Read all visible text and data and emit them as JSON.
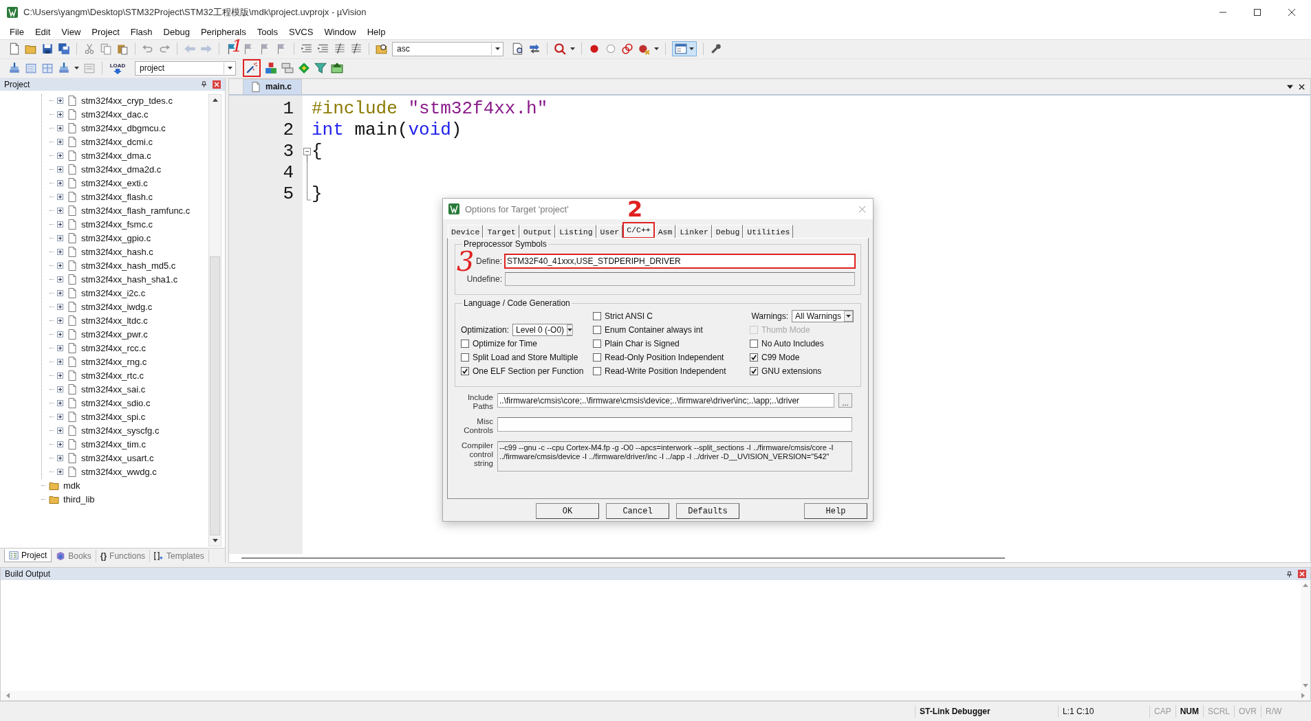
{
  "window": {
    "title": "C:\\Users\\yangm\\Desktop\\STM32Project\\STM32工程模版\\mdk\\project.uvprojx - µVision"
  },
  "menu": [
    "File",
    "Edit",
    "View",
    "Project",
    "Flash",
    "Debug",
    "Peripherals",
    "Tools",
    "SVCS",
    "Window",
    "Help"
  ],
  "toolbar": {
    "find_text": "asc",
    "target": "project",
    "load_label": "LOAD",
    "options_highlighted": true
  },
  "annotations": [
    {
      "text": "1"
    },
    {
      "text": "2"
    },
    {
      "text": "3"
    }
  ],
  "project_panel": {
    "title": "Project",
    "tree": [
      {
        "kind": "group",
        "children": [
          {
            "kind": "file",
            "label": "stm32f4xx_cryp_tdes.c",
            "expanded": false
          },
          {
            "kind": "file",
            "label": "stm32f4xx_dac.c",
            "expanded": false
          },
          {
            "kind": "file",
            "label": "stm32f4xx_dbgmcu.c",
            "expanded": false
          },
          {
            "kind": "file",
            "label": "stm32f4xx_dcmi.c",
            "expanded": false
          },
          {
            "kind": "file",
            "label": "stm32f4xx_dma.c",
            "expanded": false
          },
          {
            "kind": "file",
            "label": "stm32f4xx_dma2d.c",
            "expanded": false
          },
          {
            "kind": "file",
            "label": "stm32f4xx_exti.c",
            "expanded": false
          },
          {
            "kind": "file",
            "label": "stm32f4xx_flash.c",
            "expanded": false
          },
          {
            "kind": "file",
            "label": "stm32f4xx_flash_ramfunc.c",
            "expanded": false
          },
          {
            "kind": "file",
            "label": "stm32f4xx_fsmc.c",
            "expanded": false
          },
          {
            "kind": "file",
            "label": "stm32f4xx_gpio.c",
            "expanded": false
          },
          {
            "kind": "file",
            "label": "stm32f4xx_hash.c",
            "expanded": false
          },
          {
            "kind": "file",
            "label": "stm32f4xx_hash_md5.c",
            "expanded": false
          },
          {
            "kind": "file",
            "label": "stm32f4xx_hash_sha1.c",
            "expanded": false
          },
          {
            "kind": "file",
            "label": "stm32f4xx_i2c.c",
            "expanded": false
          },
          {
            "kind": "file",
            "label": "stm32f4xx_iwdg.c",
            "expanded": false
          },
          {
            "kind": "file",
            "label": "stm32f4xx_ltdc.c",
            "expanded": false
          },
          {
            "kind": "file",
            "label": "stm32f4xx_pwr.c",
            "expanded": false
          },
          {
            "kind": "file",
            "label": "stm32f4xx_rcc.c",
            "expanded": false
          },
          {
            "kind": "file",
            "label": "stm32f4xx_rng.c",
            "expanded": false
          },
          {
            "kind": "file",
            "label": "stm32f4xx_rtc.c",
            "expanded": false
          },
          {
            "kind": "file",
            "label": "stm32f4xx_sai.c",
            "expanded": false
          },
          {
            "kind": "file",
            "label": "stm32f4xx_sdio.c",
            "expanded": false
          },
          {
            "kind": "file",
            "label": "stm32f4xx_spi.c",
            "expanded": false
          },
          {
            "kind": "file",
            "label": "stm32f4xx_syscfg.c",
            "expanded": false
          },
          {
            "kind": "file",
            "label": "stm32f4xx_tim.c",
            "expanded": false
          },
          {
            "kind": "file",
            "label": "stm32f4xx_usart.c",
            "expanded": false
          },
          {
            "kind": "file",
            "label": "stm32f4xx_wwdg.c",
            "expanded": false
          }
        ]
      },
      {
        "kind": "folder",
        "label": "mdk"
      },
      {
        "kind": "folder",
        "label": "third_lib"
      }
    ],
    "tabs": [
      {
        "label": "Project",
        "selected": true
      },
      {
        "label": "Books",
        "selected": false
      },
      {
        "label": "Functions",
        "glyph": "{}",
        "selected": false
      },
      {
        "label": "Templates",
        "selected": false
      }
    ]
  },
  "editor": {
    "tabs": [
      {
        "label": "main.c",
        "selected": true
      }
    ],
    "lines": [
      {
        "number": "1",
        "tokens": [
          {
            "kind": "preprocessor",
            "text": "#include "
          },
          {
            "kind": "string",
            "text": "\"stm32f4xx.h\""
          }
        ]
      },
      {
        "number": "2",
        "tokens": [
          {
            "kind": "keyword",
            "text": "int"
          },
          {
            "kind": "plain",
            "text": " main("
          },
          {
            "kind": "keyword",
            "text": "void"
          },
          {
            "kind": "plain",
            "text": ")"
          }
        ]
      },
      {
        "number": "3",
        "fold_open": true,
        "tokens": [
          {
            "kind": "plain",
            "text": "{"
          }
        ]
      },
      {
        "number": "4"
      },
      {
        "number": "5",
        "tokens": [
          {
            "kind": "plain",
            "text": "}"
          }
        ]
      }
    ]
  },
  "dialog": {
    "title": "Options for Target 'project'",
    "tabs": [
      {
        "label": "Device",
        "selected": false
      },
      {
        "label": "Target",
        "selected": false
      },
      {
        "label": "Output",
        "selected": false
      },
      {
        "label": "Listing",
        "selected": false
      },
      {
        "label": "User",
        "selected": false
      },
      {
        "label": "C/C++",
        "selected": true,
        "highlighted": true
      },
      {
        "label": "Asm",
        "selected": false
      },
      {
        "label": "Linker",
        "selected": false
      },
      {
        "label": "Debug",
        "selected": false
      },
      {
        "label": "Utilities",
        "selected": false
      }
    ],
    "preprocessor": {
      "title": "Preprocessor Symbols",
      "define": {
        "label": "Define:",
        "value": "STM32F40_41xxx,USE_STDPERIPH_DRIVER",
        "highlighted": true
      },
      "undefine": {
        "label": "Undefine:",
        "disabled": true
      }
    },
    "language": {
      "title": "Language / Code Generation",
      "columns": [
        [
          {
            "kind": "select",
            "label": "Optimization:",
            "value": "Level 0 (-O0)"
          },
          {
            "kind": "checkbox",
            "label": "Optimize for Time",
            "checked": false,
            "disabled": false
          },
          {
            "kind": "checkbox",
            "label": "Split Load and Store Multiple",
            "checked": false,
            "disabled": false
          },
          {
            "kind": "checkbox",
            "label": "One ELF Section per Function",
            "checked": true,
            "disabled": false
          }
        ],
        [
          {
            "kind": "checkbox",
            "label": "Strict ANSI C",
            "checked": false,
            "disabled": false
          },
          {
            "kind": "checkbox",
            "label": "Enum Container always int",
            "checked": false,
            "disabled": false
          },
          {
            "kind": "checkbox",
            "label": "Plain Char is Signed",
            "checked": false,
            "disabled": false
          },
          {
            "kind": "checkbox",
            "label": "Read-Only Position Independent",
            "checked": false,
            "disabled": false
          },
          {
            "kind": "checkbox",
            "label": "Read-Write Position Independent",
            "checked": false,
            "disabled": false
          }
        ],
        [
          {
            "kind": "select",
            "label": "Warnings:",
            "value": "All Warnings"
          },
          {
            "kind": "checkbox",
            "label": "Thumb Mode",
            "checked": false,
            "disabled": true
          },
          {
            "kind": "checkbox",
            "label": "No Auto Includes",
            "checked": false,
            "disabled": false
          },
          {
            "kind": "checkbox",
            "label": "C99 Mode",
            "checked": true,
            "disabled": false
          },
          {
            "kind": "checkbox",
            "label": "GNU extensions",
            "checked": true,
            "disabled": false
          }
        ]
      ]
    },
    "include_paths": {
      "label": "Include Paths",
      "value": "..\\firmware\\cmsis\\core;..\\firmware\\cmsis\\device;..\\firmware\\driver\\inc;..\\app;..\\driver",
      "browse": "..."
    },
    "misc_controls": {
      "label": "Misc Controls"
    },
    "compiler_string": {
      "label": "Compiler control string",
      "value": "--c99 --gnu -c --cpu Cortex-M4.fp -g -O0 --apcs=interwork --split_sections -I ../firmware/cmsis/core -I ../firmware/cmsis/device -I ../firmware/driver/inc -I ../app -I ../driver -D__UVISION_VERSION=\"542\""
    },
    "buttons": [
      {
        "label": "OK"
      },
      {
        "label": "Cancel"
      },
      {
        "label": "Defaults"
      },
      {
        "label": "Help"
      }
    ]
  },
  "build_output": {
    "title": "Build Output"
  },
  "status_bar": {
    "debugger": "ST-Link Debugger",
    "position": "L:1 C:10",
    "indicators": [
      {
        "label": "CAP",
        "on": false
      },
      {
        "label": "NUM",
        "on": true
      },
      {
        "label": "SCRL",
        "on": false
      },
      {
        "label": "OVR",
        "on": false
      },
      {
        "label": "R/W",
        "on": false
      }
    ]
  }
}
